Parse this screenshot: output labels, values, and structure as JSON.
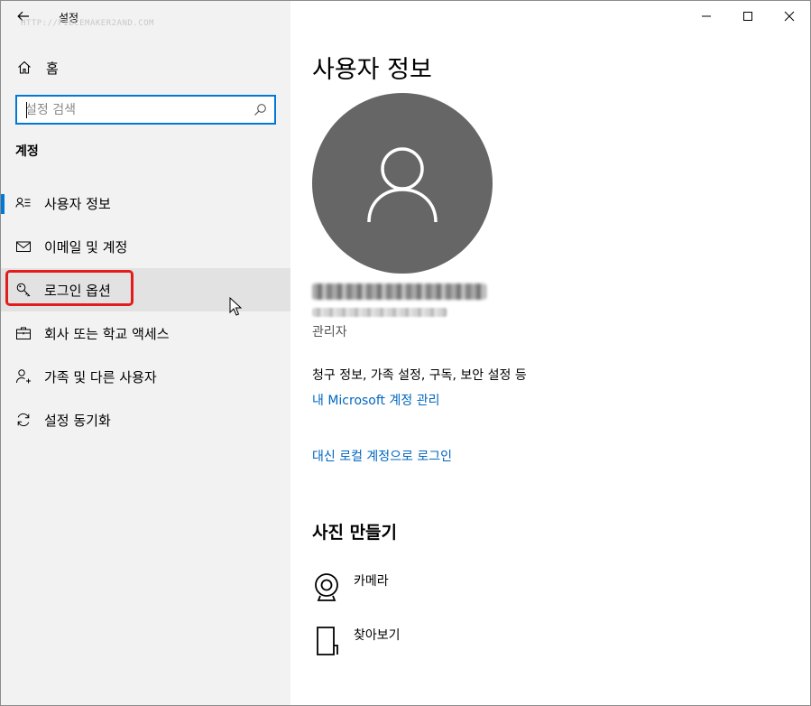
{
  "window": {
    "title": "설정",
    "watermark": "HTTP://PIECEMAKER2AND.COM",
    "controls": {
      "minimize": "minimize-icon",
      "maximize": "maximize-icon",
      "close": "close-icon"
    }
  },
  "sidebar": {
    "back_icon": "back-arrow-icon",
    "home_label": "홈",
    "search_placeholder": "설정 검색",
    "section_title": "계정",
    "items": [
      {
        "label": "사용자 정보",
        "icon": "user-info-icon",
        "selected": true
      },
      {
        "label": "이메일 및 계정",
        "icon": "mail-icon"
      },
      {
        "label": "로그인 옵션",
        "icon": "key-icon",
        "hovered": true,
        "highlighted": true
      },
      {
        "label": "회사 또는 학교 액세스",
        "icon": "briefcase-icon"
      },
      {
        "label": "가족 및 다른 사용자",
        "icon": "person-add-icon"
      },
      {
        "label": "설정 동기화",
        "icon": "sync-icon"
      }
    ],
    "highlight_color": "#e21b1b",
    "accent_color": "#0078d7"
  },
  "main": {
    "title": "사용자 정보",
    "role": "관리자",
    "billing_text": "청구 정보, 가족 설정, 구독, 보안 설정 등",
    "ms_account_link": "내 Microsoft 계정 관리",
    "local_account_link": "대신 로컬 계정으로 로그인",
    "photo_section_title": "사진 만들기",
    "photo_options": [
      {
        "label": "카메라",
        "icon": "webcam-icon"
      },
      {
        "label": "찾아보기",
        "icon": "file-browse-icon"
      }
    ],
    "link_color": "#0067c0",
    "avatar_color": "#666666"
  }
}
